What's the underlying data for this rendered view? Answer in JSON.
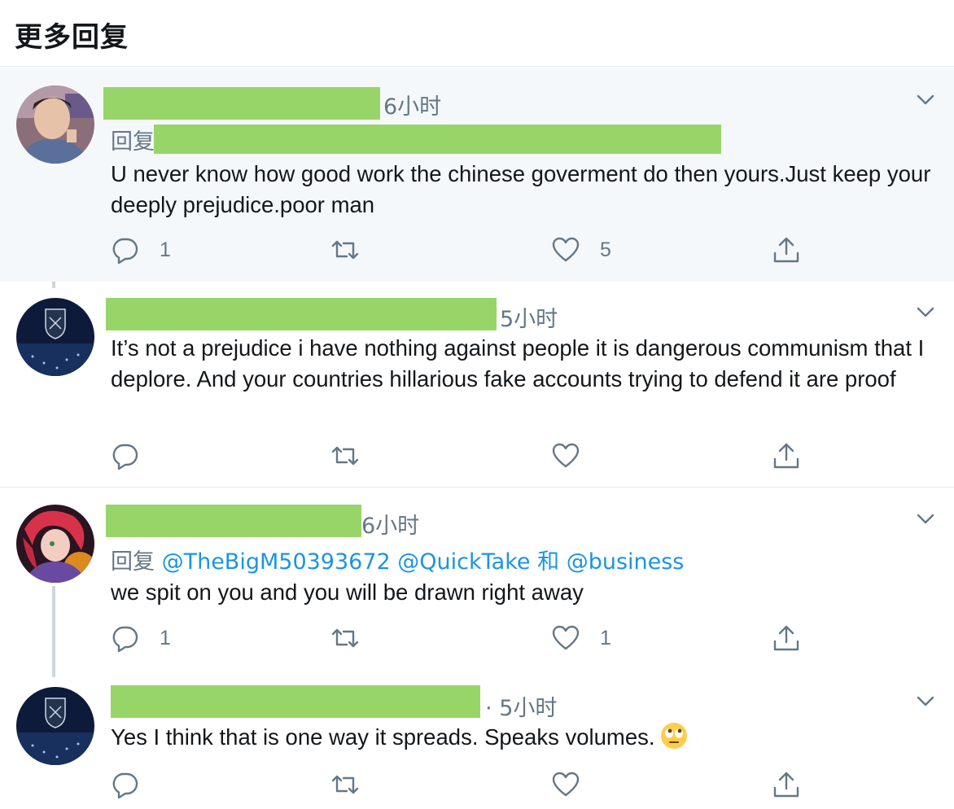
{
  "header": {
    "title": "更多回复"
  },
  "reply_prefix": "回复",
  "tweets": [
    {
      "time": "6小时",
      "text": "U never know how good work the chinese goverment do then yours.Just keep your deeply prejudice.poor man",
      "reply_count": "1",
      "like_count": "5"
    },
    {
      "time": "5小时",
      "text": "It’s not a prejudice i have nothing against people it is dangerous communism that I deplore. And your countries hillarious fake accounts trying to defend it are proof",
      "reply_count": "",
      "like_count": ""
    },
    {
      "time": "6小时",
      "mention1": "@TheBigM50393672",
      "mention2": "@QuickTake",
      "conj": "和",
      "mention3": "@business",
      "text": "we spit on you and you will be drawn right away",
      "reply_count": "1",
      "like_count": "1"
    },
    {
      "time_sep": "·",
      "time": "5小时",
      "text": "Yes I think that is one way it spreads. Speaks volumes.",
      "emoji": "face-with-rolling-eyes",
      "reply_count": "",
      "like_count": ""
    }
  ],
  "colors": {
    "accent": "#1b95e0",
    "redaction": "#98d568",
    "muted": "#657786",
    "highlight_bg": "#f5f8fa"
  }
}
